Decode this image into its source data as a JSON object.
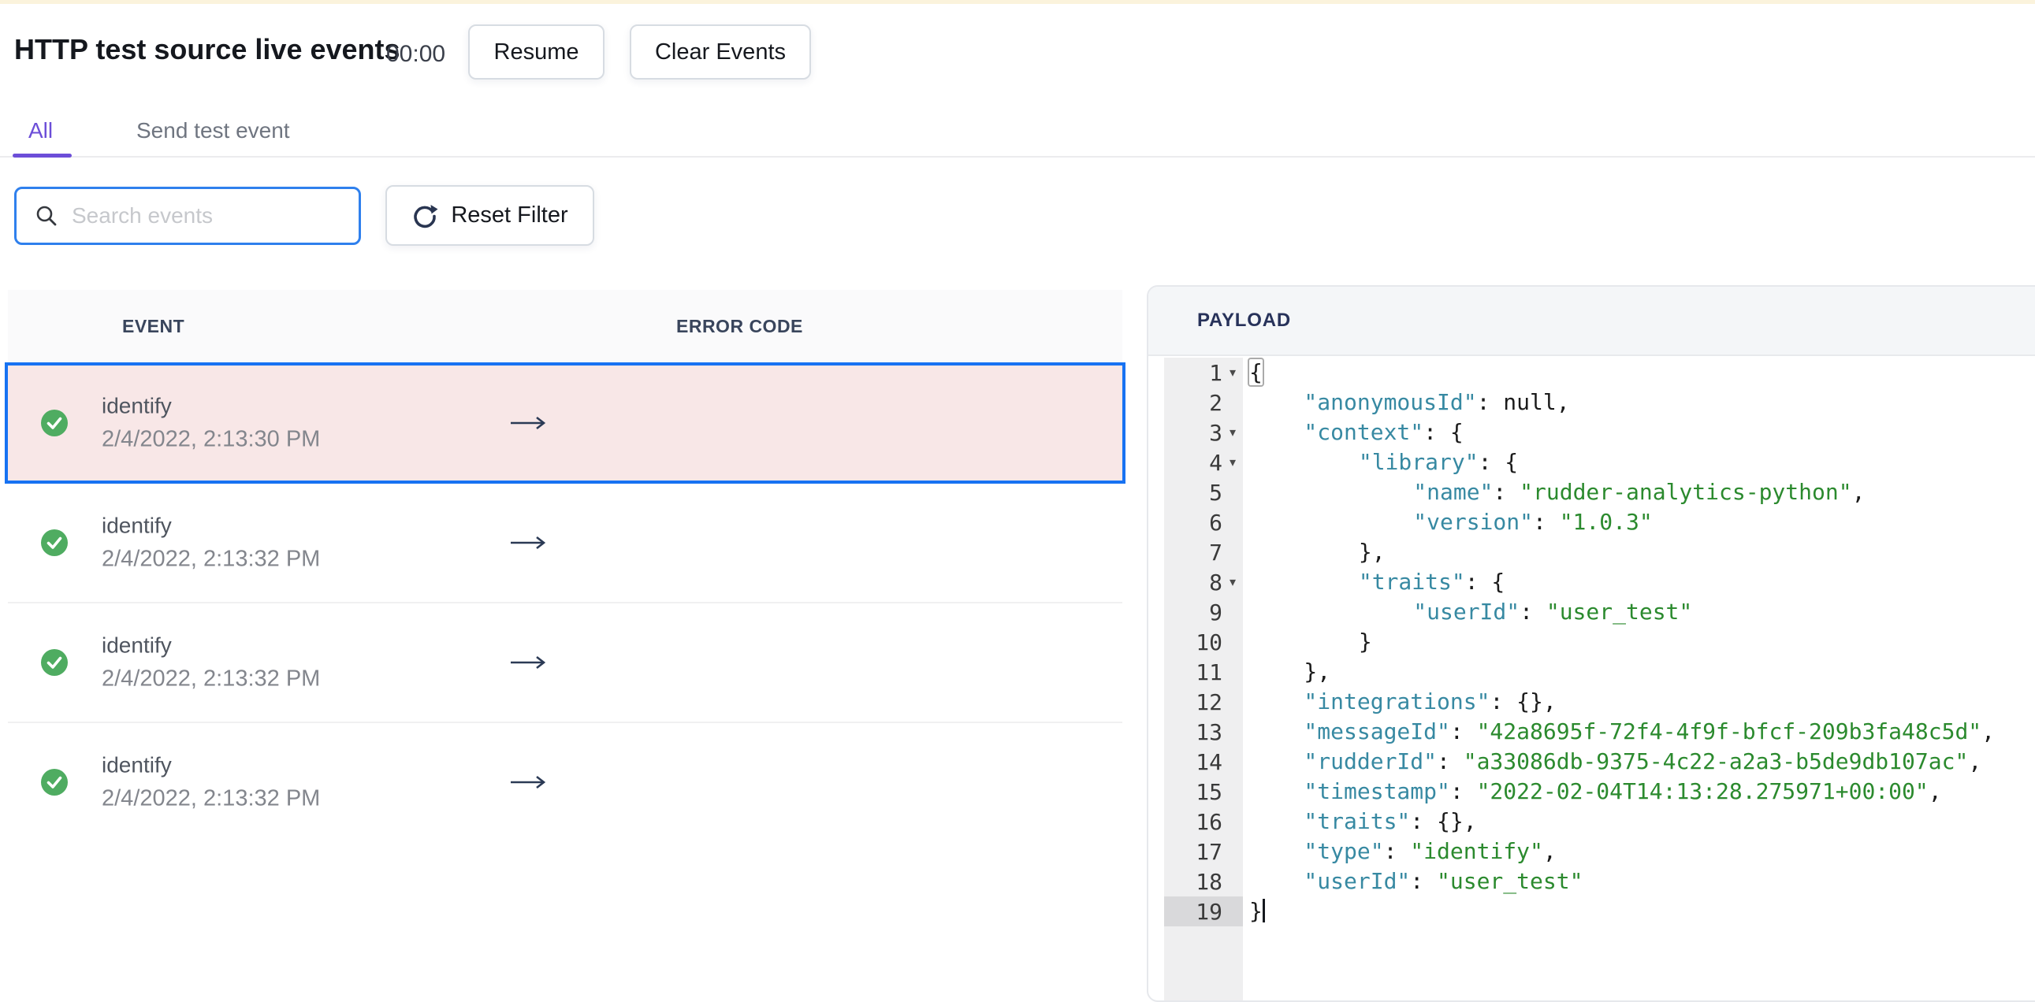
{
  "header": {
    "title": "HTTP test source live events",
    "timer": "00:00",
    "resume_label": "Resume",
    "clear_label": "Clear Events"
  },
  "tabs": [
    {
      "label": "All",
      "active": true
    },
    {
      "label": "Send test event",
      "active": false
    }
  ],
  "filter": {
    "search_placeholder": "Search events",
    "reset_label": "Reset Filter"
  },
  "events_table": {
    "columns": [
      "EVENT",
      "ERROR CODE"
    ],
    "rows": [
      {
        "name": "identify",
        "timestamp": "2/4/2022, 2:13:30 PM",
        "status": "success",
        "selected": true
      },
      {
        "name": "identify",
        "timestamp": "2/4/2022, 2:13:32 PM",
        "status": "success",
        "selected": false
      },
      {
        "name": "identify",
        "timestamp": "2/4/2022, 2:13:32 PM",
        "status": "success",
        "selected": false
      },
      {
        "name": "identify",
        "timestamp": "2/4/2022, 2:13:32 PM",
        "status": "success",
        "selected": false
      }
    ]
  },
  "colors": {
    "accent_purple": "#6C4ED8",
    "selected_border_blue": "#1772F2",
    "selected_bg_pink": "#F8E7E7",
    "success_green": "#4FAC61",
    "search_focus_blue": "#2F80ED",
    "json_key_teal": "#3789A2",
    "json_string_green": "#2B8A2E"
  },
  "payload": {
    "title": "PAYLOAD",
    "lines": [
      {
        "n": 1,
        "ind": 0,
        "fold": true,
        "active": false,
        "tokens": [
          {
            "c": "pb",
            "t": "{"
          }
        ]
      },
      {
        "n": 2,
        "ind": 1,
        "fold": false,
        "active": false,
        "tokens": [
          {
            "c": "k",
            "t": "\"anonymousId\""
          },
          {
            "c": "p",
            "t": ": null,"
          }
        ]
      },
      {
        "n": 3,
        "ind": 1,
        "fold": true,
        "active": false,
        "tokens": [
          {
            "c": "k",
            "t": "\"context\""
          },
          {
            "c": "p",
            "t": ": {"
          }
        ]
      },
      {
        "n": 4,
        "ind": 2,
        "fold": true,
        "active": false,
        "tokens": [
          {
            "c": "k",
            "t": "\"library\""
          },
          {
            "c": "p",
            "t": ": {"
          }
        ]
      },
      {
        "n": 5,
        "ind": 3,
        "fold": false,
        "active": false,
        "tokens": [
          {
            "c": "k",
            "t": "\"name\""
          },
          {
            "c": "p",
            "t": ": "
          },
          {
            "c": "s",
            "t": "\"rudder-analytics-python\""
          },
          {
            "c": "p",
            "t": ","
          }
        ]
      },
      {
        "n": 6,
        "ind": 3,
        "fold": false,
        "active": false,
        "tokens": [
          {
            "c": "k",
            "t": "\"version\""
          },
          {
            "c": "p",
            "t": ": "
          },
          {
            "c": "s",
            "t": "\"1.0.3\""
          }
        ]
      },
      {
        "n": 7,
        "ind": 2,
        "fold": false,
        "active": false,
        "tokens": [
          {
            "c": "p",
            "t": "},"
          }
        ]
      },
      {
        "n": 8,
        "ind": 2,
        "fold": true,
        "active": false,
        "tokens": [
          {
            "c": "k",
            "t": "\"traits\""
          },
          {
            "c": "p",
            "t": ": {"
          }
        ]
      },
      {
        "n": 9,
        "ind": 3,
        "fold": false,
        "active": false,
        "tokens": [
          {
            "c": "k",
            "t": "\"userId\""
          },
          {
            "c": "p",
            "t": ": "
          },
          {
            "c": "s",
            "t": "\"user_test\""
          }
        ]
      },
      {
        "n": 10,
        "ind": 2,
        "fold": false,
        "active": false,
        "tokens": [
          {
            "c": "p",
            "t": "}"
          }
        ]
      },
      {
        "n": 11,
        "ind": 1,
        "fold": false,
        "active": false,
        "tokens": [
          {
            "c": "p",
            "t": "},"
          }
        ]
      },
      {
        "n": 12,
        "ind": 1,
        "fold": false,
        "active": false,
        "tokens": [
          {
            "c": "k",
            "t": "\"integrations\""
          },
          {
            "c": "p",
            "t": ": {},"
          }
        ]
      },
      {
        "n": 13,
        "ind": 1,
        "fold": false,
        "active": false,
        "tokens": [
          {
            "c": "k",
            "t": "\"messageId\""
          },
          {
            "c": "p",
            "t": ": "
          },
          {
            "c": "s",
            "t": "\"42a8695f-72f4-4f9f-bfcf-209b3fa48c5d\""
          },
          {
            "c": "p",
            "t": ","
          }
        ]
      },
      {
        "n": 14,
        "ind": 1,
        "fold": false,
        "active": false,
        "tokens": [
          {
            "c": "k",
            "t": "\"rudderId\""
          },
          {
            "c": "p",
            "t": ": "
          },
          {
            "c": "s",
            "t": "\"a33086db-9375-4c22-a2a3-b5de9db107ac\""
          },
          {
            "c": "p",
            "t": ","
          }
        ]
      },
      {
        "n": 15,
        "ind": 1,
        "fold": false,
        "active": false,
        "tokens": [
          {
            "c": "k",
            "t": "\"timestamp\""
          },
          {
            "c": "p",
            "t": ": "
          },
          {
            "c": "s",
            "t": "\"2022-02-04T14:13:28.275971+00:00\""
          },
          {
            "c": "p",
            "t": ","
          }
        ]
      },
      {
        "n": 16,
        "ind": 1,
        "fold": false,
        "active": false,
        "tokens": [
          {
            "c": "k",
            "t": "\"traits\""
          },
          {
            "c": "p",
            "t": ": {},"
          }
        ]
      },
      {
        "n": 17,
        "ind": 1,
        "fold": false,
        "active": false,
        "tokens": [
          {
            "c": "k",
            "t": "\"type\""
          },
          {
            "c": "p",
            "t": ": "
          },
          {
            "c": "s",
            "t": "\"identify\""
          },
          {
            "c": "p",
            "t": ","
          }
        ]
      },
      {
        "n": 18,
        "ind": 1,
        "fold": false,
        "active": false,
        "tokens": [
          {
            "c": "k",
            "t": "\"userId\""
          },
          {
            "c": "p",
            "t": ": "
          },
          {
            "c": "s",
            "t": "\"user_test\""
          }
        ]
      },
      {
        "n": 19,
        "ind": 0,
        "fold": false,
        "active": true,
        "cursor": true,
        "tokens": [
          {
            "c": "p",
            "t": "}"
          }
        ]
      }
    ]
  }
}
